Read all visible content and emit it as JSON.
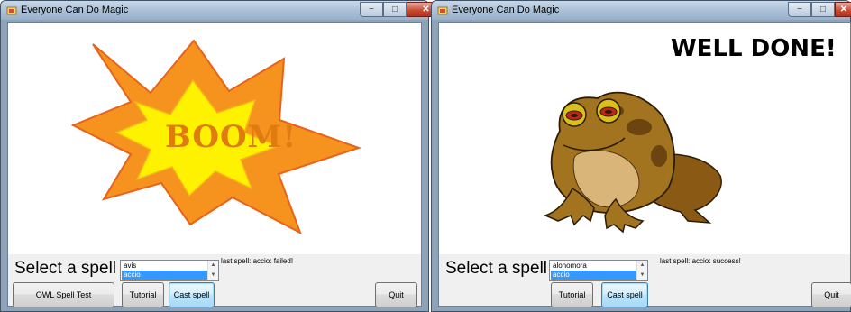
{
  "windows": [
    {
      "title": "Everyone Can Do Magic",
      "picture": {
        "art": "explosion",
        "text": "BOOM!"
      },
      "select_label": "Select a spell",
      "spell_list": [
        "avis",
        "accio"
      ],
      "selected_spell": "accio",
      "status": "last spell: accio: failed!",
      "buttons": {
        "owl": "OWL Spell Test",
        "tutorial": "Tutorial",
        "cast": "Cast spell",
        "quit": "Quit"
      }
    },
    {
      "title": "Everyone Can Do Magic",
      "picture": {
        "art": "hypnotoad",
        "text": "WELL DONE!"
      },
      "select_label": "Select a spell",
      "spell_list": [
        "alohomora",
        "accio"
      ],
      "selected_spell": "accio",
      "status": "last spell: accio: success!",
      "buttons": {
        "tutorial": "Tutorial",
        "cast": "Cast spell",
        "quit": "Quit"
      }
    }
  ],
  "caption_buttons": {
    "minimize": "−",
    "maximize": "□",
    "close": "✕"
  },
  "icons": [
    "app-icon",
    "minimize-icon",
    "maximize-icon",
    "close-icon",
    "scroll-up-icon",
    "scroll-down-icon"
  ],
  "colors": {
    "explosion_outer": "#f6921e",
    "explosion_inner": "#fff200",
    "boom_text": "#e07b10",
    "selection": "#3399ff"
  }
}
